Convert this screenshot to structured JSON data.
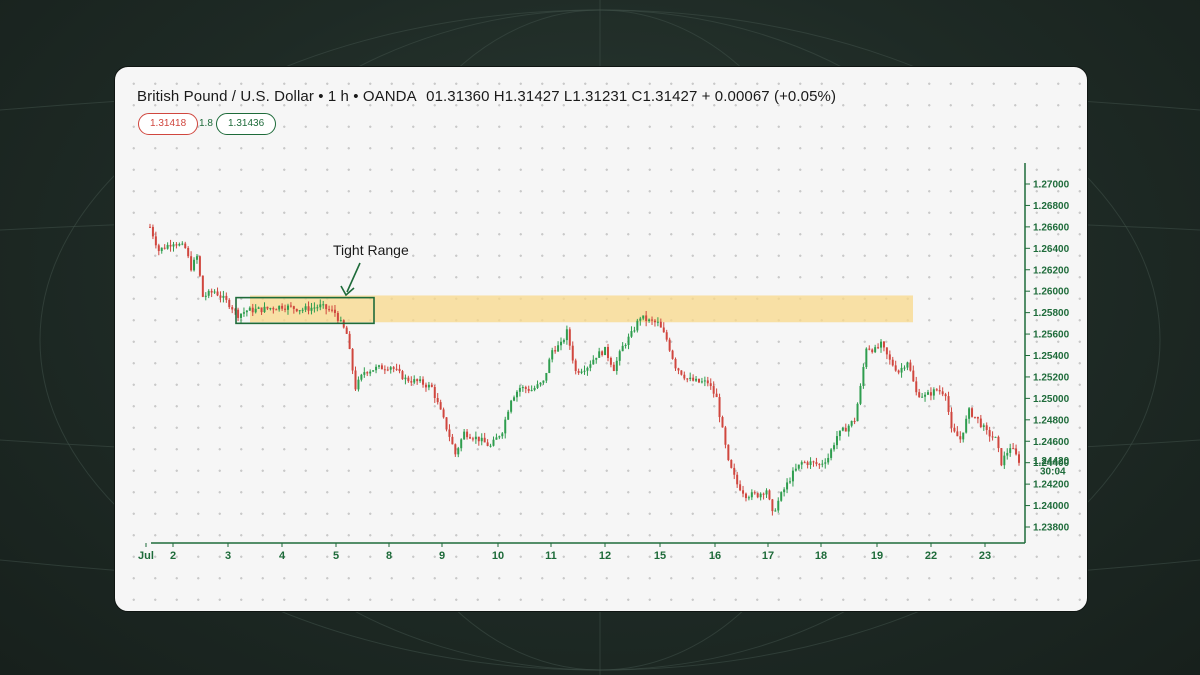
{
  "header": {
    "symbol": "British Pound / U.S. Dollar • 1 h • OANDA",
    "ohlc": "01.31360 H1.31427 L1.31231 C1.31427 + 0.00067 (+0.05%)"
  },
  "quote": {
    "sell": "1.31418",
    "spread": "1.8",
    "buy": "1.31436"
  },
  "chart_data": {
    "type": "candlestick",
    "colors": {
      "up": "#2e9d4e",
      "down": "#d0463e",
      "axis": "#1e6b3a",
      "range_box": "#1e6b3a",
      "zone": "#f8d889"
    },
    "x_labels": [
      "Jul",
      "2",
      "3",
      "4",
      "5",
      "8",
      "9",
      "10",
      "11",
      "12",
      "15",
      "16",
      "17",
      "18",
      "19",
      "22",
      "23"
    ],
    "y_ticks": [
      "1.27000",
      "1.26800",
      "1.26600",
      "1.26400",
      "1.26200",
      "1.26000",
      "1.25800",
      "1.25600",
      "1.25400",
      "1.25200",
      "1.25000",
      "1.24800",
      "1.24600",
      "1.24400",
      "1.24200",
      "1.24000",
      "1.23800"
    ],
    "ylim": [
      1.236,
      1.272
    ],
    "last_price": "1.24420",
    "countdown": "30:04",
    "annotation": "Tight Range",
    "tight_range": {
      "start_day": "3",
      "end_day": "5",
      "low": 1.257,
      "high": 1.2594
    },
    "resistance_zone": {
      "low": 1.2571,
      "high": 1.2596
    },
    "path": [
      [
        0,
        1.266
      ],
      [
        3,
        1.2638
      ],
      [
        8,
        1.2646
      ],
      [
        12,
        1.264
      ],
      [
        14,
        1.2622
      ],
      [
        16,
        1.2632
      ],
      [
        18,
        1.2595
      ],
      [
        22,
        1.26
      ],
      [
        27,
        1.2588
      ],
      [
        30,
        1.2578
      ],
      [
        33,
        1.2582
      ],
      [
        38,
        1.2583
      ],
      [
        45,
        1.2586
      ],
      [
        52,
        1.2583
      ],
      [
        58,
        1.2586
      ],
      [
        63,
        1.258
      ],
      [
        67,
        1.256
      ],
      [
        70,
        1.251
      ],
      [
        73,
        1.2525
      ],
      [
        77,
        1.2528
      ],
      [
        82,
        1.253
      ],
      [
        87,
        1.2518
      ],
      [
        92,
        1.2515
      ],
      [
        96,
        1.251
      ],
      [
        100,
        1.248
      ],
      [
        102,
        1.2465
      ],
      [
        104,
        1.2448
      ],
      [
        107,
        1.2468
      ],
      [
        112,
        1.2462
      ],
      [
        116,
        1.2455
      ],
      [
        120,
        1.247
      ],
      [
        123,
        1.25
      ],
      [
        126,
        1.251
      ],
      [
        130,
        1.2508
      ],
      [
        134,
        1.2515
      ],
      [
        137,
        1.2545
      ],
      [
        140,
        1.255
      ],
      [
        142,
        1.2562
      ],
      [
        145,
        1.2525
      ],
      [
        149,
        1.253
      ],
      [
        152,
        1.254
      ],
      [
        155,
        1.2545
      ],
      [
        158,
        1.2528
      ],
      [
        161,
        1.2548
      ],
      [
        164,
        1.256
      ],
      [
        167,
        1.2576
      ],
      [
        170,
        1.2572
      ],
      [
        173,
        1.257
      ],
      [
        176,
        1.2555
      ],
      [
        179,
        1.253
      ],
      [
        183,
        1.2518
      ],
      [
        187,
        1.2515
      ],
      [
        190,
        1.2515
      ],
      [
        193,
        1.25
      ],
      [
        195,
        1.247
      ],
      [
        197,
        1.244
      ],
      [
        200,
        1.242
      ],
      [
        203,
        1.241
      ],
      [
        207,
        1.241
      ],
      [
        210,
        1.2415
      ],
      [
        212,
        1.2392
      ],
      [
        215,
        1.241
      ],
      [
        219,
        1.243
      ],
      [
        222,
        1.244
      ],
      [
        225,
        1.244
      ],
      [
        228,
        1.2438
      ],
      [
        231,
        1.2445
      ],
      [
        234,
        1.2465
      ],
      [
        237,
        1.2472
      ],
      [
        240,
        1.248
      ],
      [
        242,
        1.251
      ],
      [
        244,
        1.2548
      ],
      [
        247,
        1.2545
      ],
      [
        249,
        1.255
      ],
      [
        252,
        1.2535
      ],
      [
        255,
        1.2525
      ],
      [
        258,
        1.2535
      ],
      [
        261,
        1.2505
      ],
      [
        264,
        1.2502
      ],
      [
        268,
        1.2508
      ],
      [
        271,
        1.2505
      ],
      [
        273,
        1.247
      ],
      [
        276,
        1.2462
      ],
      [
        279,
        1.2488
      ],
      [
        282,
        1.248
      ],
      [
        285,
        1.2468
      ],
      [
        288,
        1.2462
      ],
      [
        290,
        1.244
      ],
      [
        293,
        1.2455
      ],
      [
        296,
        1.2442
      ]
    ]
  }
}
